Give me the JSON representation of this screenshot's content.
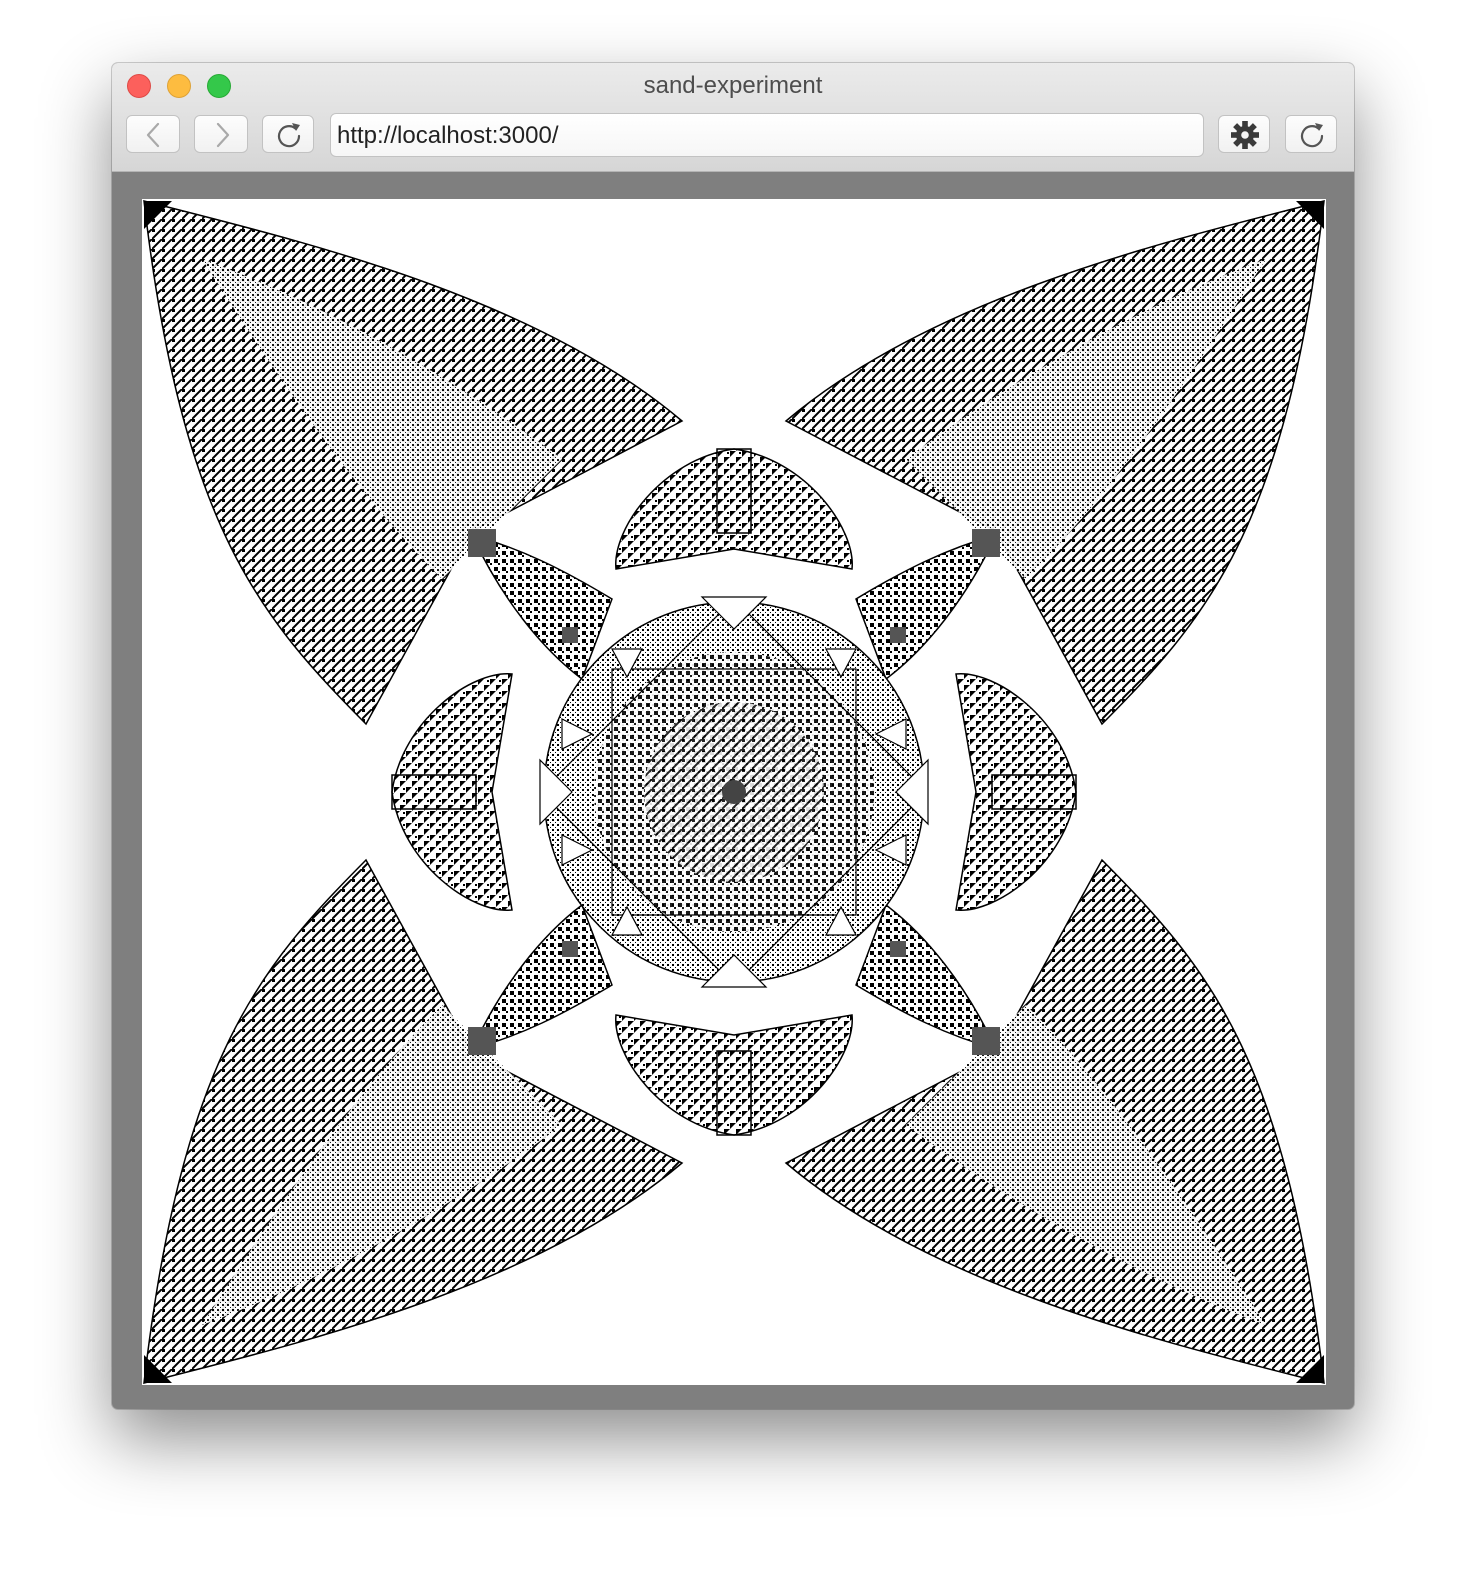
{
  "window": {
    "title": "sand-experiment"
  },
  "toolbar": {
    "back_icon": "chevron-left-icon",
    "forward_icon": "chevron-right-icon",
    "reload_icon": "reload-icon",
    "settings_icon": "gear-icon",
    "refresh_icon": "reload-icon"
  },
  "address_bar": {
    "url": "http://localhost:3000/"
  },
  "content": {
    "description_kind": "sandpile-simulation-canvas",
    "colors": {
      "frame": "#7f7f7f",
      "ink": "#000000",
      "background": "#ffffff"
    }
  }
}
